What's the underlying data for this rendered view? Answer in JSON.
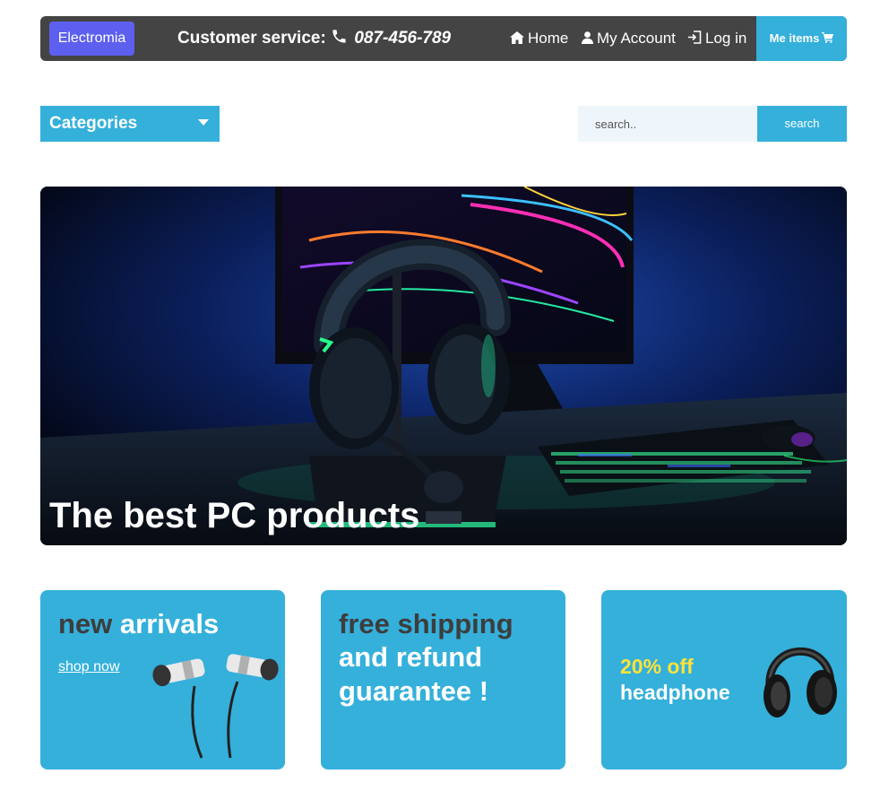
{
  "header": {
    "logo": "Electromia",
    "customer_service_label": "Customer service:",
    "customer_service_phone": "087-456-789",
    "nav": {
      "home": "Home",
      "account": "My Account",
      "login": "Log in"
    },
    "cart_label": "Me items"
  },
  "toolbar": {
    "categories_label": "Categories",
    "search_placeholder": "search..",
    "search_button": "search"
  },
  "hero": {
    "title": "The best PC products"
  },
  "promos": {
    "card1": {
      "title_dark": "new",
      "title_light": "arrivals",
      "link": "shop now"
    },
    "card2": {
      "line1": "free shipping",
      "line2": "and refund",
      "line3": "guarantee !"
    },
    "card3": {
      "discount": "20% off",
      "product": "headphone"
    }
  },
  "icons": {
    "phone": "phone-icon",
    "home": "home-icon",
    "user": "user-icon",
    "login": "login-icon",
    "cart": "cart-icon",
    "caret": "caret-down-icon"
  },
  "colors": {
    "topbar": "#444444",
    "logo_bg": "#5d5fef",
    "accent": "#34b0db",
    "search_bg": "#eef6fb",
    "discount": "#ffe23a",
    "dark_text": "#3d3d3d"
  }
}
